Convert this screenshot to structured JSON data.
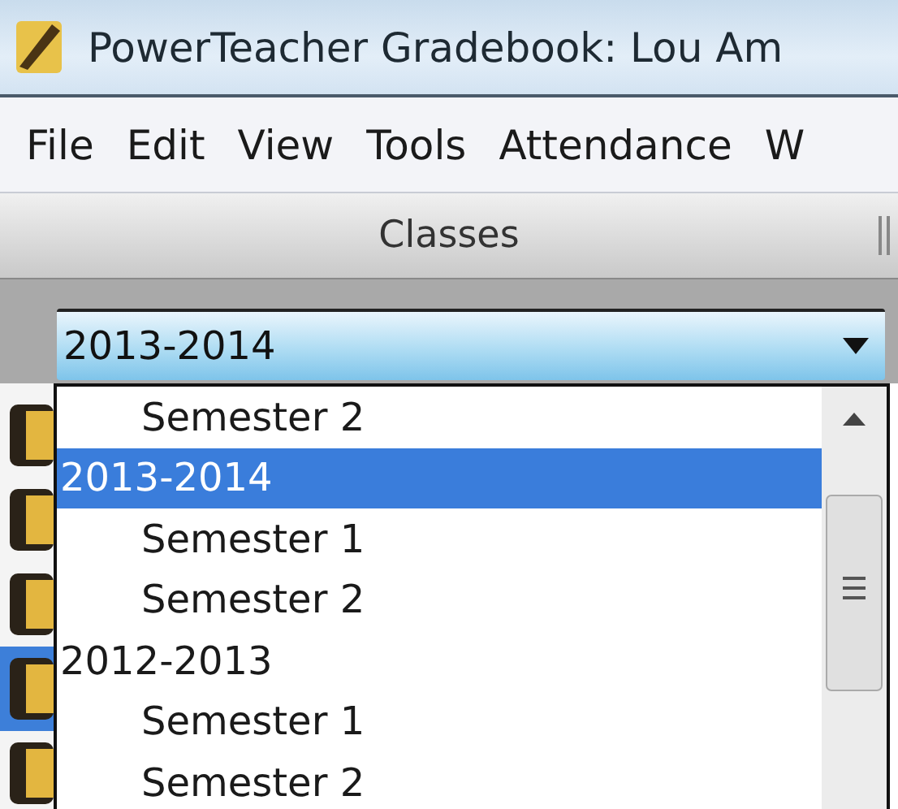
{
  "window": {
    "title": "PowerTeacher Gradebook: Lou Am"
  },
  "menu": [
    "File",
    "Edit",
    "View",
    "Tools",
    "Attendance",
    "W"
  ],
  "panel": {
    "title": "Classes"
  },
  "term_select": {
    "value": "2013-2014"
  },
  "class_rows": [
    {
      "selected": false
    },
    {
      "selected": false
    },
    {
      "selected": false
    },
    {
      "selected": true
    },
    {
      "selected": false
    }
  ],
  "dropdown": {
    "items": [
      {
        "label": "Semester 2",
        "kind": "term",
        "selected": false
      },
      {
        "label": "2013-2014",
        "kind": "year",
        "selected": true
      },
      {
        "label": "Semester 1",
        "kind": "term",
        "selected": false
      },
      {
        "label": "Semester 2",
        "kind": "term",
        "selected": false
      },
      {
        "label": "2012-2013",
        "kind": "year",
        "selected": false
      },
      {
        "label": "Semester 1",
        "kind": "term",
        "selected": false
      },
      {
        "label": "Semester 2",
        "kind": "term",
        "selected": false
      }
    ]
  }
}
